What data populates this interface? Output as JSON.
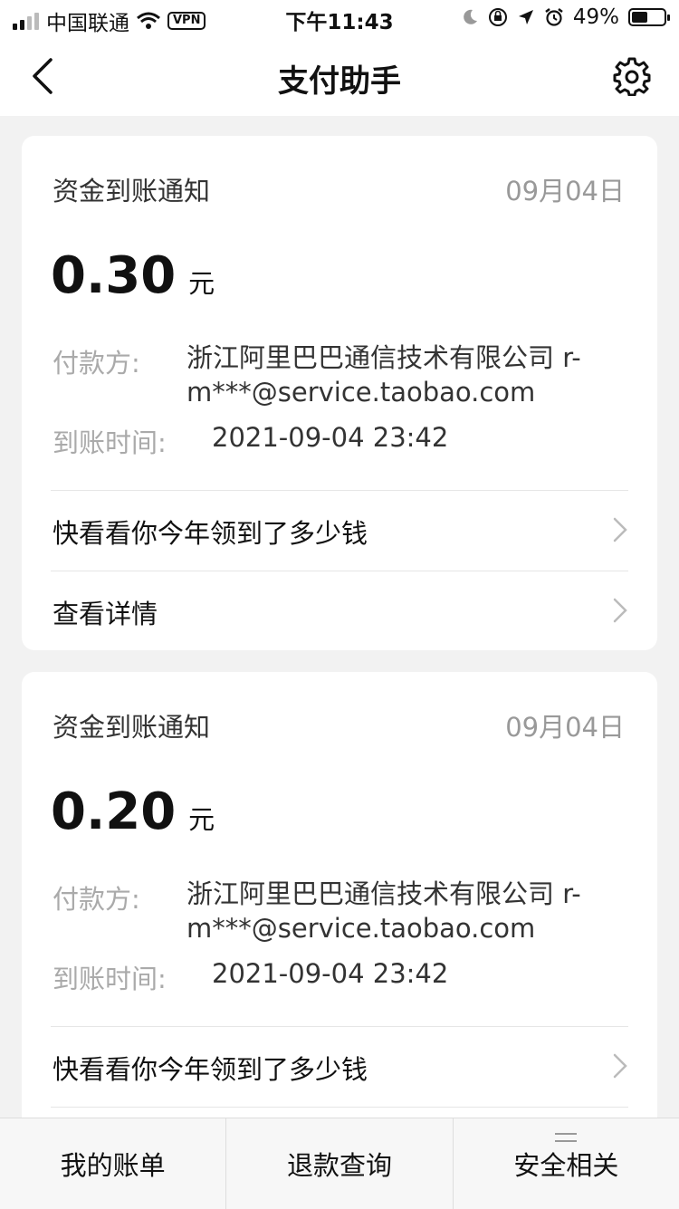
{
  "status_bar": {
    "carrier": "中国联通",
    "vpn": "VPN",
    "time": "下午11:43",
    "battery": "49%"
  },
  "nav": {
    "title": "支付助手"
  },
  "cards": [
    {
      "title": "资金到账通知",
      "date": "09月04日",
      "amount": "0.30",
      "unit": "元",
      "payer_label": "付款方:",
      "payer_value": "浙江阿里巴巴通信技术有限公司 r-m***@service.taobao.com",
      "time_label": "到账时间:",
      "time_value": "2021-09-04 23:42",
      "link1": "快看看你今年领到了多少钱",
      "link2": "查看详情"
    },
    {
      "title": "资金到账通知",
      "date": "09月04日",
      "amount": "0.20",
      "unit": "元",
      "payer_label": "付款方:",
      "payer_value": "浙江阿里巴巴通信技术有限公司 r-m***@service.taobao.com",
      "time_label": "到账时间:",
      "time_value": "2021-09-04 23:42",
      "link1": "快看看你今年领到了多少钱"
    }
  ],
  "tabbar": {
    "tab1": "我的账单",
    "tab2": "退款查询",
    "tab3": "安全相关"
  },
  "icons": {
    "back": "chevron-left-icon",
    "settings": "gear-icon",
    "row_arrow": "chevron-right-icon"
  },
  "battery_level": 0.49
}
